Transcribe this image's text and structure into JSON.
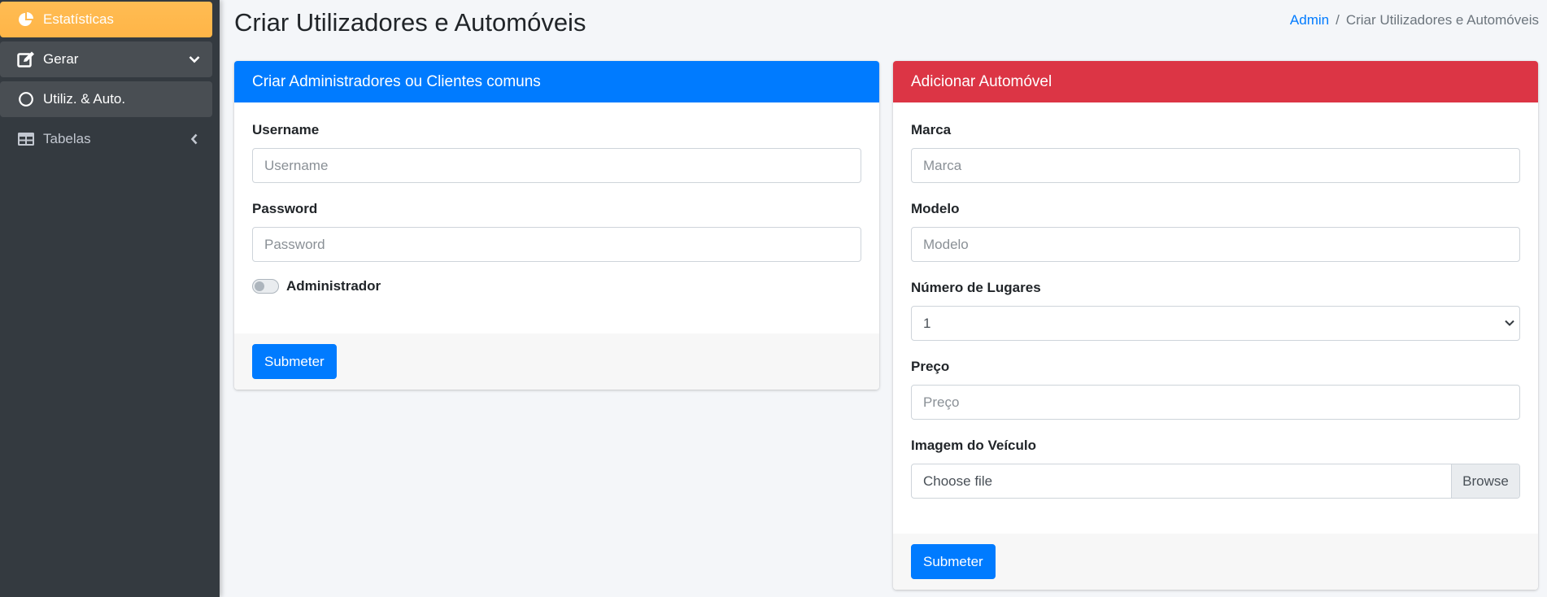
{
  "sidebar": {
    "items": [
      {
        "label": "Estatísticas",
        "icon": "pie-chart-icon"
      },
      {
        "label": "Gerar",
        "icon": "edit-icon",
        "chevron": "chevron-down-icon"
      },
      {
        "label": "Utiliz. & Auto.",
        "icon": "circle-icon"
      },
      {
        "label": "Tabelas",
        "icon": "table-icon",
        "chevron": "chevron-left-icon"
      }
    ]
  },
  "header": {
    "title": "Criar Utilizadores e Automóveis",
    "breadcrumb": {
      "home": "Admin",
      "separator": "/",
      "current": "Criar Utilizadores e Automóveis"
    }
  },
  "user_card": {
    "title": "Criar Administradores ou Clientes comuns",
    "header_color": "#007bff",
    "username": {
      "label": "Username",
      "placeholder": "Username",
      "value": ""
    },
    "password": {
      "label": "Password",
      "placeholder": "Password",
      "value": ""
    },
    "admin_switch": {
      "label": "Administrador",
      "checked": false
    },
    "submit_label": "Submeter"
  },
  "car_card": {
    "title": "Adicionar Automóvel",
    "header_color": "#dc3545",
    "marca": {
      "label": "Marca",
      "placeholder": "Marca",
      "value": ""
    },
    "modelo": {
      "label": "Modelo",
      "placeholder": "Modelo",
      "value": ""
    },
    "lugares": {
      "label": "Número de Lugares",
      "selected": "1"
    },
    "preco": {
      "label": "Preço",
      "placeholder": "Preço",
      "value": ""
    },
    "imagem": {
      "label": "Imagem do Veículo",
      "file_text": "Choose file",
      "browse_label": "Browse"
    },
    "submit_label": "Submeter"
  },
  "colors": {
    "sidebar_bg": "#343a40",
    "warning": "#ffb84d",
    "primary": "#007bff",
    "danger": "#dc3545"
  }
}
